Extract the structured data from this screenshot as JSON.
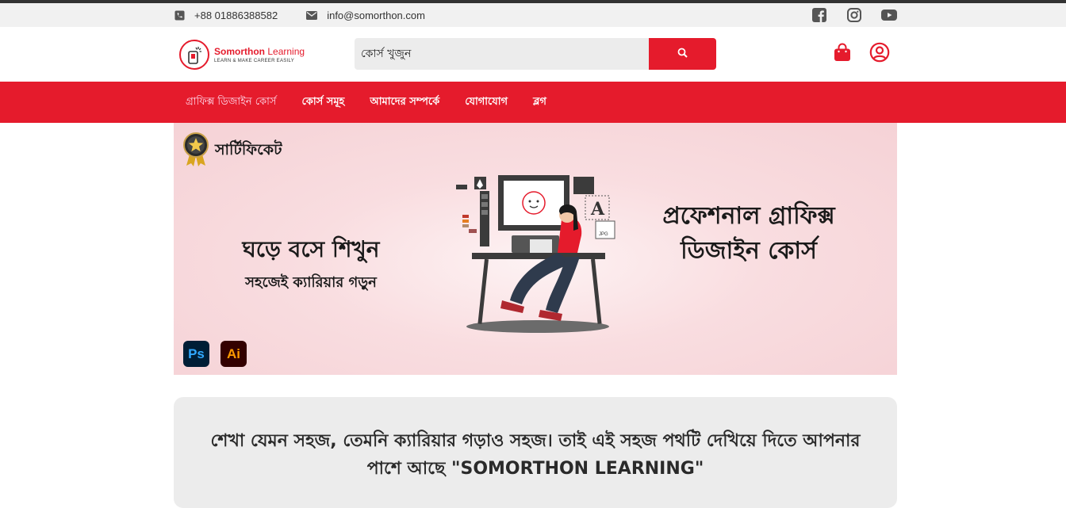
{
  "topbar": {
    "phone": "+88 01886388582",
    "email": "info@somorthon.com",
    "icons": [
      "phone-icon",
      "mail-icon",
      "facebook-icon",
      "instagram-icon",
      "youtube-icon"
    ]
  },
  "logo": {
    "name": "Somorthon",
    "name2": "Learning",
    "tagline": "LEARN & MAKE CAREER EASILY"
  },
  "search": {
    "placeholder": "কোর্স খুজুন",
    "button_icon": "search-icon"
  },
  "nav": {
    "items": [
      "গ্রাফিক্স ডিজাইন কোর্স",
      "কোর্স সমূহ",
      "আমাদের সম্পর্কে",
      "যোগাযোগ",
      "ব্লগ"
    ]
  },
  "banner": {
    "certificate": "সার্টিফিকেট",
    "left_line1": "ঘড়ে বসে শিখুন",
    "left_line2": "সহজেই ক্যারিয়ার গড়ুন",
    "right_title": "প্রফেশনাল গ্রাফিক্স ডিজাইন কোর্স",
    "badge_ps": "Ps",
    "badge_ai": "Ai",
    "illus_letter": "A",
    "illus_tag": "JPG"
  },
  "intro": {
    "text": "শেখা যেমন সহজ, তেমনি ক্যারিয়ার গড়াও সহজ। তাই এই সহজ পথটি দেখিয়ে দিতে আপনার পাশে আছে \"SOMORTHON LEARNING\""
  },
  "colors": {
    "brand_red": "#e51b2c",
    "topbar_bg": "#f1f1f1",
    "banner_bg": "#f9dde0"
  }
}
